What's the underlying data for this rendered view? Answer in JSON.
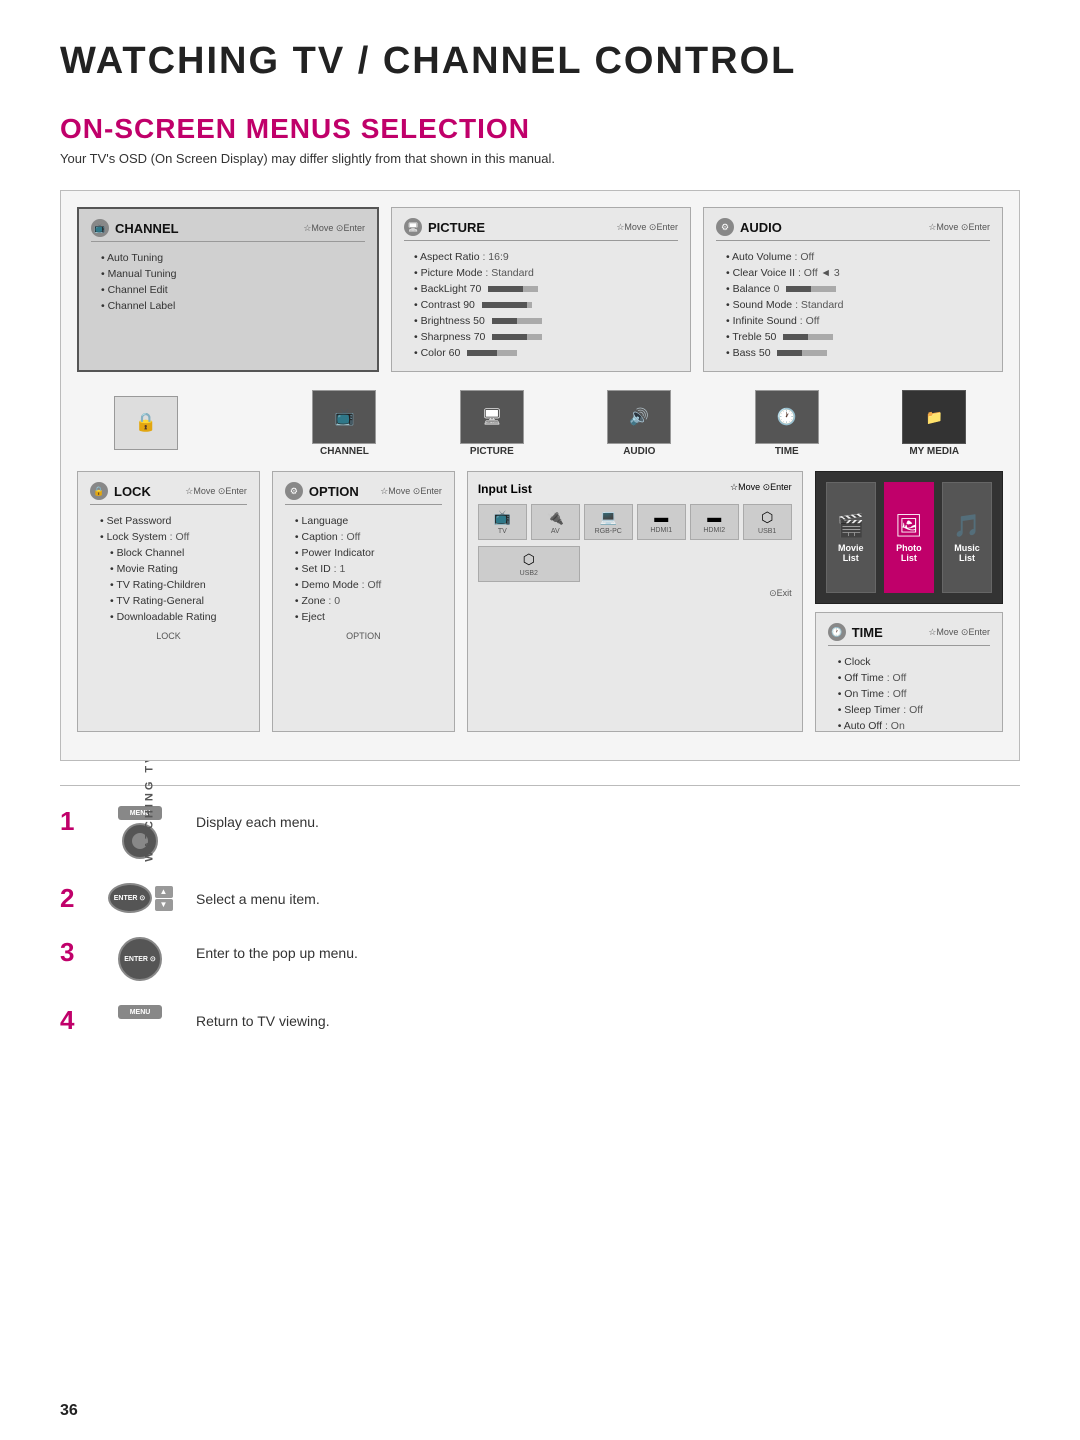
{
  "page": {
    "main_title": "WATCHING TV / CHANNEL CONTROL",
    "section_title": "ON-SCREEN MENUS SELECTION",
    "section_subtitle": "Your TV's OSD (On Screen Display) may differ slightly from that shown in this manual.",
    "page_number": "36",
    "side_label": "WATCHING TV / CHANNEL CONTROL"
  },
  "osd": {
    "nav_hint": "Move   Enter",
    "panels": {
      "channel": {
        "title": "CHANNEL",
        "items": [
          "Auto Tuning",
          "Manual Tuning",
          "Channel Edit",
          "Channel Label"
        ]
      },
      "picture": {
        "title": "PICTURE",
        "items": [
          {
            "label": "Aspect Ratio",
            "value": ": 16:9"
          },
          {
            "label": "Picture Mode",
            "value": ": Standard"
          },
          {
            "label": "BackLight",
            "value": "70"
          },
          {
            "label": "Contrast",
            "value": "90"
          },
          {
            "label": "Brightness",
            "value": "50"
          },
          {
            "label": "Sharpness",
            "value": "70"
          },
          {
            "label": "Color",
            "value": "60"
          }
        ]
      },
      "audio": {
        "title": "AUDIO",
        "items": [
          {
            "label": "Auto Volume",
            "value": ": Off"
          },
          {
            "label": "Clear Voice II",
            "value": ": Off ◄ 3"
          },
          {
            "label": "Balance",
            "value": "0"
          },
          {
            "label": "Sound Mode",
            "value": ": Standard"
          },
          {
            "label": "Infinite Sound",
            "value": ": Off"
          },
          {
            "label": "Treble",
            "value": "50"
          },
          {
            "label": "Bass",
            "value": "50"
          }
        ]
      },
      "lock": {
        "title": "LOCK",
        "items": [
          {
            "label": "Set Password"
          },
          {
            "label": "Lock System",
            "value": ": Off"
          },
          {
            "label": "Block Channel"
          },
          {
            "label": "Movie Rating"
          },
          {
            "label": "TV Rating-Children"
          },
          {
            "label": "TV Rating-General"
          },
          {
            "label": "Downloadable Rating"
          }
        ]
      },
      "option": {
        "title": "OPTION",
        "items": [
          {
            "label": "Language"
          },
          {
            "label": "Caption",
            "value": ": Off"
          },
          {
            "label": "Power Indicator"
          },
          {
            "label": "Set ID",
            "value": ": 1"
          },
          {
            "label": "Demo Mode",
            "value": ": Off"
          },
          {
            "label": "Zone",
            "value": ": 0"
          },
          {
            "label": "Eject"
          }
        ]
      },
      "time": {
        "title": "TIME",
        "items": [
          {
            "label": "Clock"
          },
          {
            "label": "Off Time",
            "value": ": Off"
          },
          {
            "label": "On Time",
            "value": ": Off"
          },
          {
            "label": "Sleep Timer",
            "value": ": Off"
          },
          {
            "label": "Auto Off",
            "value": ": On"
          }
        ]
      }
    },
    "bottom_icons": [
      {
        "label": "CHANNEL",
        "icon": "📺"
      },
      {
        "label": "PICTURE",
        "icon": "🖥"
      },
      {
        "label": "AUDIO",
        "icon": "🔊"
      },
      {
        "label": "TIME",
        "icon": "🕐"
      }
    ],
    "input_list": {
      "title": "Input List",
      "nav": "Move   Enter",
      "inputs": [
        "TV",
        "AV",
        "RGB-PC",
        "HDMI1",
        "HDMI2",
        "USB1",
        "USB2"
      ],
      "exit_label": "Exit"
    },
    "mymedia": {
      "title": "MY MEDIA",
      "items": [
        {
          "label": "Movie List",
          "icon": "🎬"
        },
        {
          "label": "Photo List",
          "icon": "🖼"
        },
        {
          "label": "Music List",
          "icon": "🎵"
        }
      ]
    }
  },
  "instructions": [
    {
      "number": "1",
      "button": "MENU",
      "text": "Display each menu."
    },
    {
      "number": "2",
      "button": "ENTER",
      "text": "Select a menu item."
    },
    {
      "number": "3",
      "button": "ENTER",
      "text": "Enter to the pop up menu."
    },
    {
      "number": "4",
      "button": "MENU",
      "text": "Return to TV viewing."
    }
  ]
}
